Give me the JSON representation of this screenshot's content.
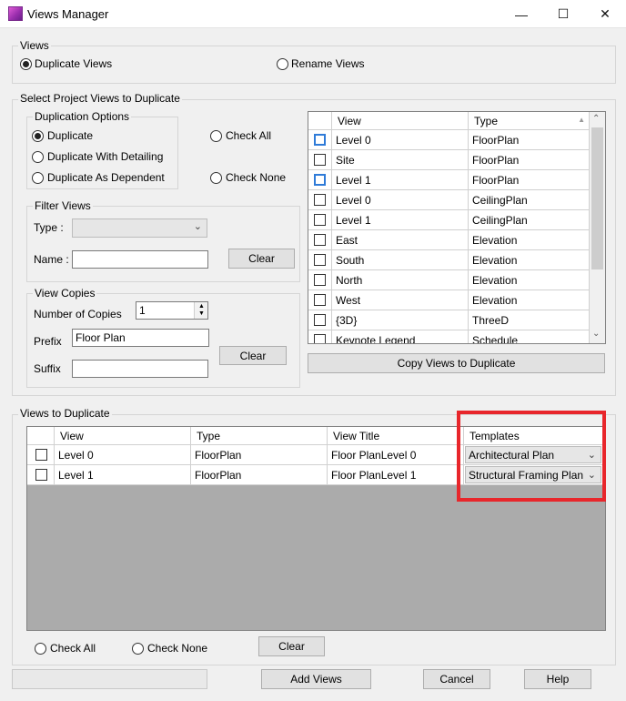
{
  "window": {
    "title": "Views Manager",
    "icon": "views-manager-app-icon",
    "controls": {
      "minimize": "—",
      "maximize": "☐",
      "close": "✕"
    }
  },
  "views_group": {
    "label": "Views",
    "options": [
      {
        "label": "Duplicate Views",
        "checked": true
      },
      {
        "label": "Rename Views",
        "checked": false
      }
    ]
  },
  "select_group": {
    "label": "Select Project Views to Duplicate",
    "duplication_options": {
      "label": "Duplication Options",
      "options": [
        {
          "label": "Duplicate",
          "checked": true
        },
        {
          "label": "Duplicate With Detailing",
          "checked": false
        },
        {
          "label": "Duplicate As Dependent",
          "checked": false
        }
      ]
    },
    "check_all": "Check All",
    "check_none": "Check None",
    "filter": {
      "label": "Filter Views",
      "type_label": "Type :",
      "type_value": "",
      "name_label": "Name :",
      "name_value": "",
      "clear": "Clear"
    },
    "copies": {
      "label": "View Copies",
      "number_label": "Number of Copies",
      "number_value": "1",
      "prefix_label": "Prefix",
      "prefix_value": "Floor Plan",
      "suffix_label": "Suffix",
      "suffix_value": "",
      "clear": "Clear"
    },
    "table": {
      "columns": [
        "View",
        "Type"
      ],
      "rows": [
        {
          "view": "Level 0",
          "type": "FloorPlan",
          "focused": true
        },
        {
          "view": "Site",
          "type": "FloorPlan",
          "focused": false
        },
        {
          "view": "Level 1",
          "type": "FloorPlan",
          "focused": true
        },
        {
          "view": "Level 0",
          "type": "CeilingPlan",
          "focused": false
        },
        {
          "view": "Level 1",
          "type": "CeilingPlan",
          "focused": false
        },
        {
          "view": "East",
          "type": "Elevation",
          "focused": false
        },
        {
          "view": "South",
          "type": "Elevation",
          "focused": false
        },
        {
          "view": "North",
          "type": "Elevation",
          "focused": false
        },
        {
          "view": "West",
          "type": "Elevation",
          "focused": false
        },
        {
          "view": "{3D}",
          "type": "ThreeD",
          "focused": false
        },
        {
          "view": "Keynote Legend",
          "type": "Schedule",
          "focused": false
        }
      ]
    },
    "copy_button": "Copy Views to Duplicate"
  },
  "duplicate_group": {
    "label": "Views to Duplicate",
    "columns": [
      "View",
      "Type",
      "View Title",
      "Templates"
    ],
    "rows": [
      {
        "view": "Level 0",
        "type": "FloorPlan",
        "title": "Floor PlanLevel 0",
        "template": "Architectural Plan"
      },
      {
        "view": "Level 1",
        "type": "FloorPlan",
        "title": "Floor PlanLevel 1",
        "template": "Structural Framing Plan"
      }
    ],
    "check_all": "Check All",
    "check_none": "Check None",
    "clear": "Clear"
  },
  "footer": {
    "status": "",
    "add_views": "Add Views",
    "cancel": "Cancel",
    "help": "Help"
  },
  "colors": {
    "highlight": "#e8262b",
    "focus": "#2f7bd8",
    "grid_empty": "#ababab"
  }
}
